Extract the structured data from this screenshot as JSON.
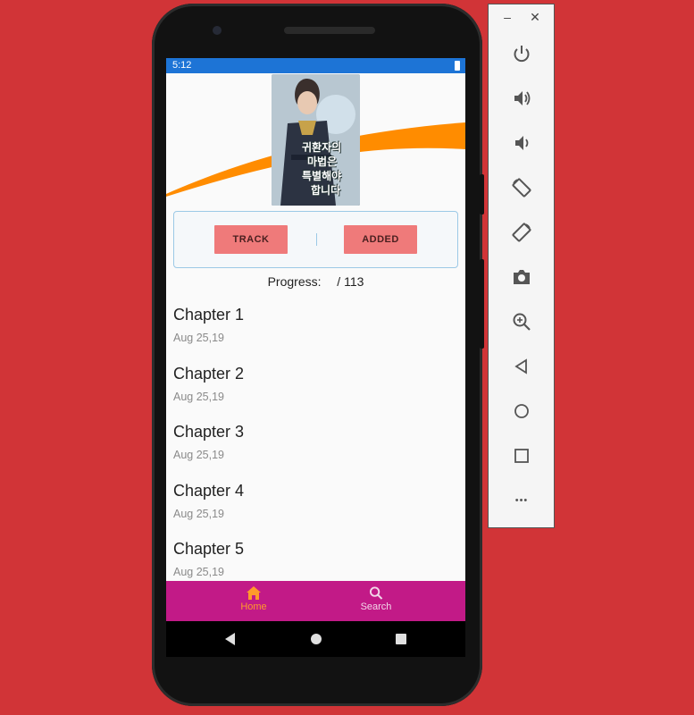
{
  "status_bar": {
    "time": "5:12"
  },
  "manga": {
    "cover_alt": "Manga cover",
    "cover_title_lines": [
      "귀환자의",
      "마법은",
      "특별해야",
      "합니다"
    ]
  },
  "actions": {
    "track_label": "TRACK",
    "added_label": "ADDED"
  },
  "progress": {
    "label": "Progress:",
    "current": "",
    "total": "/ 113"
  },
  "chapters": [
    {
      "title": "Chapter 1",
      "date": "Aug 25,19"
    },
    {
      "title": "Chapter 2",
      "date": "Aug 25,19"
    },
    {
      "title": "Chapter 3",
      "date": "Aug 25,19"
    },
    {
      "title": "Chapter 4",
      "date": "Aug 25,19"
    },
    {
      "title": "Chapter 5",
      "date": "Aug 25,19"
    }
  ],
  "bottom_nav": {
    "items": [
      {
        "label": "Home",
        "icon": "home-icon",
        "active": true
      },
      {
        "label": "Search",
        "icon": "search-icon",
        "active": false
      }
    ]
  },
  "emulator": {
    "window_controls": {
      "minimize": "–",
      "close": "✕"
    },
    "more_glyph": "•••",
    "buttons": [
      "power-icon",
      "volume-up-icon",
      "volume-down-icon",
      "rotate-left-icon",
      "rotate-right-icon",
      "camera-icon",
      "zoom-icon",
      "back-icon",
      "home-icon",
      "overview-icon",
      "more-icon"
    ]
  },
  "colors": {
    "background": "#d13437",
    "status_bar": "#1d74d6",
    "bottom_nav": "#c21a87",
    "nav_active": "#ff9a2b",
    "button": "#ef7a7a",
    "card_border": "#9cc9e6"
  }
}
